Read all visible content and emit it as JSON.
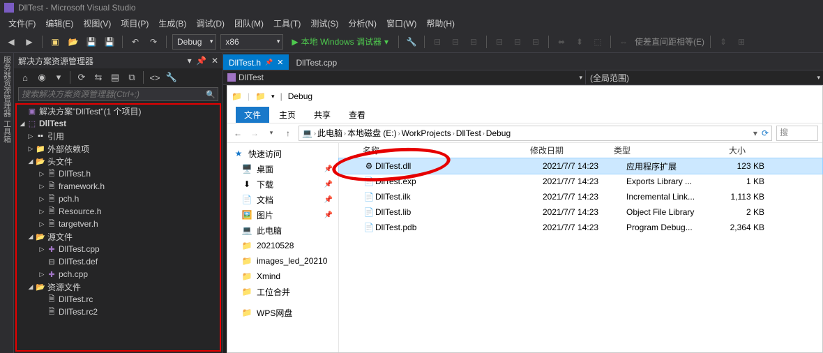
{
  "title": "DllTest - Microsoft Visual Studio",
  "menus": [
    "文件(F)",
    "编辑(E)",
    "视图(V)",
    "项目(P)",
    "生成(B)",
    "调试(D)",
    "团队(M)",
    "工具(T)",
    "测试(S)",
    "分析(N)",
    "窗口(W)",
    "帮助(H)"
  ],
  "toolbar": {
    "config": "Debug",
    "platform": "x86",
    "run": "本地 Windows 调试器",
    "spacing": "使差直间距相等(E)"
  },
  "leftbar": [
    "服务器资源管理器",
    "工具箱"
  ],
  "solution": {
    "title": "解决方案资源管理器",
    "search_placeholder": "搜索解决方案资源管理器(Ctrl+;)",
    "root": "解决方案\"DllTest\"(1 个项目)",
    "project": "DllTest",
    "refs": "引用",
    "ext": "外部依赖项",
    "headers": "头文件",
    "header_files": [
      "DllTest.h",
      "framework.h",
      "pch.h",
      "Resource.h",
      "targetver.h"
    ],
    "sources": "源文件",
    "source_files": [
      "DllTest.cpp",
      "DllTest.def",
      "pch.cpp"
    ],
    "resources": "资源文件",
    "resource_files": [
      "DllTest.rc",
      "DllTest.rc2"
    ]
  },
  "tabs": {
    "active": "DllTest.h",
    "other": "DllTest.cpp"
  },
  "nav": {
    "project": "DllTest",
    "scope": "(全局范围)"
  },
  "explorer": {
    "title": "Debug",
    "ribbon": [
      "文件",
      "主页",
      "共享",
      "查看"
    ],
    "path": [
      "此电脑",
      "本地磁盘 (E:)",
      "WorkProjects",
      "DllTest",
      "Debug"
    ],
    "search": "搜",
    "nav_head": "快速访问",
    "nav_items": [
      {
        "icon": "🖥️",
        "label": "桌面",
        "pin": true
      },
      {
        "icon": "⬇",
        "label": "下载",
        "pin": true
      },
      {
        "icon": "📄",
        "label": "文档",
        "pin": true
      },
      {
        "icon": "🖼️",
        "label": "图片",
        "pin": true
      },
      {
        "icon": "💻",
        "label": "此电脑",
        "pin": false
      },
      {
        "icon": "📁",
        "label": "20210528",
        "pin": false
      },
      {
        "icon": "📁",
        "label": "images_led_20210",
        "pin": false
      },
      {
        "icon": "📁",
        "label": "Xmind",
        "pin": false
      },
      {
        "icon": "📁",
        "label": "工位合并",
        "pin": false
      },
      {
        "icon": "📁",
        "label": "WPS网盘",
        "pin": false
      }
    ],
    "cols": {
      "name": "名称",
      "date": "修改日期",
      "type": "类型",
      "size": "大小"
    },
    "files": [
      {
        "icon": "⚙",
        "name": "DllTest.dll",
        "date": "2021/7/7 14:23",
        "type": "应用程序扩展",
        "size": "123 KB",
        "sel": true
      },
      {
        "icon": "📄",
        "name": "DllTest.exp",
        "date": "2021/7/7 14:23",
        "type": "Exports Library ...",
        "size": "1 KB"
      },
      {
        "icon": "📄",
        "name": "DllTest.ilk",
        "date": "2021/7/7 14:23",
        "type": "Incremental Link...",
        "size": "1,113 KB"
      },
      {
        "icon": "📄",
        "name": "DllTest.lib",
        "date": "2021/7/7 14:23",
        "type": "Object File Library",
        "size": "2 KB"
      },
      {
        "icon": "📄",
        "name": "DllTest.pdb",
        "date": "2021/7/7 14:23",
        "type": "Program Debug...",
        "size": "2,364 KB"
      }
    ]
  }
}
